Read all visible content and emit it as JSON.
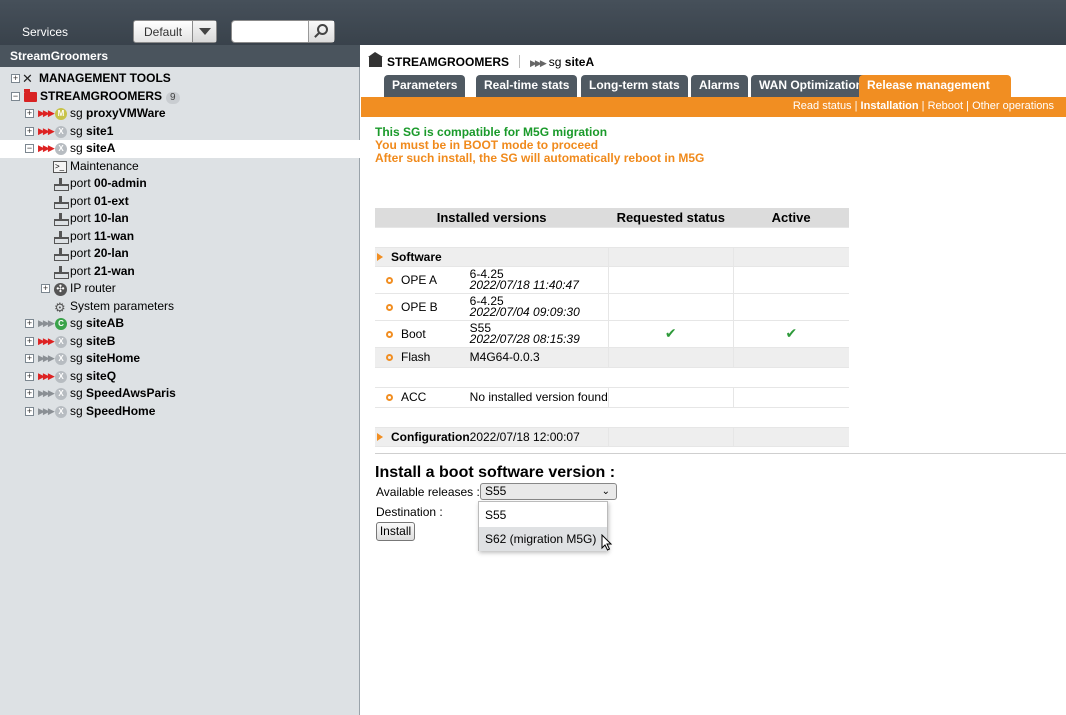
{
  "topbar": {
    "services_label": "Services",
    "profile_select": "Default",
    "search_placeholder": ""
  },
  "panel_title": "StreamGroomers",
  "tree": {
    "management_tools": "MANAGEMENT TOOLS",
    "root": {
      "label": "STREAMGROOMERS",
      "count": "9"
    },
    "items": [
      {
        "prefix": "sg ",
        "name": "proxyVMWare",
        "badge": "M"
      },
      {
        "prefix": "sg ",
        "name": "site1",
        "badge": ""
      },
      {
        "prefix": "sg ",
        "name": "siteA",
        "badge": ""
      },
      {
        "prefix": "sg ",
        "name": "siteAB",
        "badge": "C"
      },
      {
        "prefix": "sg ",
        "name": "siteB",
        "badge": ""
      },
      {
        "prefix": "sg ",
        "name": "siteHome",
        "badge": ""
      },
      {
        "prefix": "sg ",
        "name": "siteQ",
        "badge": ""
      },
      {
        "prefix": "sg ",
        "name": "SpeedAwsParis",
        "badge": ""
      },
      {
        "prefix": "sg ",
        "name": "SpeedHome",
        "badge": ""
      }
    ],
    "siteA_children": {
      "maintenance": "Maintenance",
      "ports": [
        {
          "prefix": "port ",
          "name": "00-admin"
        },
        {
          "prefix": "port ",
          "name": "01-ext"
        },
        {
          "prefix": "port ",
          "name": "10-lan"
        },
        {
          "prefix": "port ",
          "name": "11-wan"
        },
        {
          "prefix": "port ",
          "name": "20-lan"
        },
        {
          "prefix": "port ",
          "name": "21-wan"
        }
      ],
      "ip_router": "IP router",
      "system_parameters": "System parameters"
    }
  },
  "breadcrumb": {
    "root": "STREAMGROOMERS",
    "prefix": "sg ",
    "current": "siteA"
  },
  "tabs": [
    "Parameters",
    "Real-time stats",
    "Long-term stats",
    "Alarms",
    "WAN Optimization",
    "Release management"
  ],
  "subnav": {
    "read_status": "Read status",
    "sep1": " | ",
    "installation": "Installation",
    "sep2": " | ",
    "reboot": "Reboot",
    "sep3": " | ",
    "other_operations": "Other operations"
  },
  "messages": {
    "compatible": "This SG is compatible for M5G migration",
    "boot_mode": "You must be in BOOT mode to proceed",
    "reboot_note": "After such install, the SG will automatically reboot in M5G"
  },
  "versions_table": {
    "headers": [
      "Installed versions",
      "Requested status",
      "Active"
    ],
    "software_label": "Software",
    "rows": {
      "ope_a": {
        "name": "OPE A",
        "version": "6-4.25",
        "date": "2022/07/18 11:40:47"
      },
      "ope_b": {
        "name": "OPE B",
        "version": "6-4.25",
        "date": "2022/07/04 09:09:30"
      },
      "boot": {
        "name": "Boot",
        "version": "S55",
        "date": "2022/07/28 08:15:39",
        "requested": "✔",
        "active": "✔"
      },
      "flash": {
        "name": "Flash",
        "version": "M4G64-0.0.3"
      },
      "acc": {
        "name": "ACC",
        "version": "No installed version found"
      }
    },
    "configuration": {
      "name": "Configuration",
      "date": "2022/07/18 12:00:07"
    }
  },
  "install": {
    "title": "Install a boot software version :",
    "available_label": "Available releases :",
    "selected_release": "S55",
    "destination_label": "Destination :",
    "button": "Install",
    "options": [
      "S55",
      "S62 (migration M5G)"
    ]
  },
  "colors": {
    "accent": "#f18e22",
    "dark": "#4f5962",
    "success": "#1a9a2a",
    "warning": "#f08a1c"
  }
}
